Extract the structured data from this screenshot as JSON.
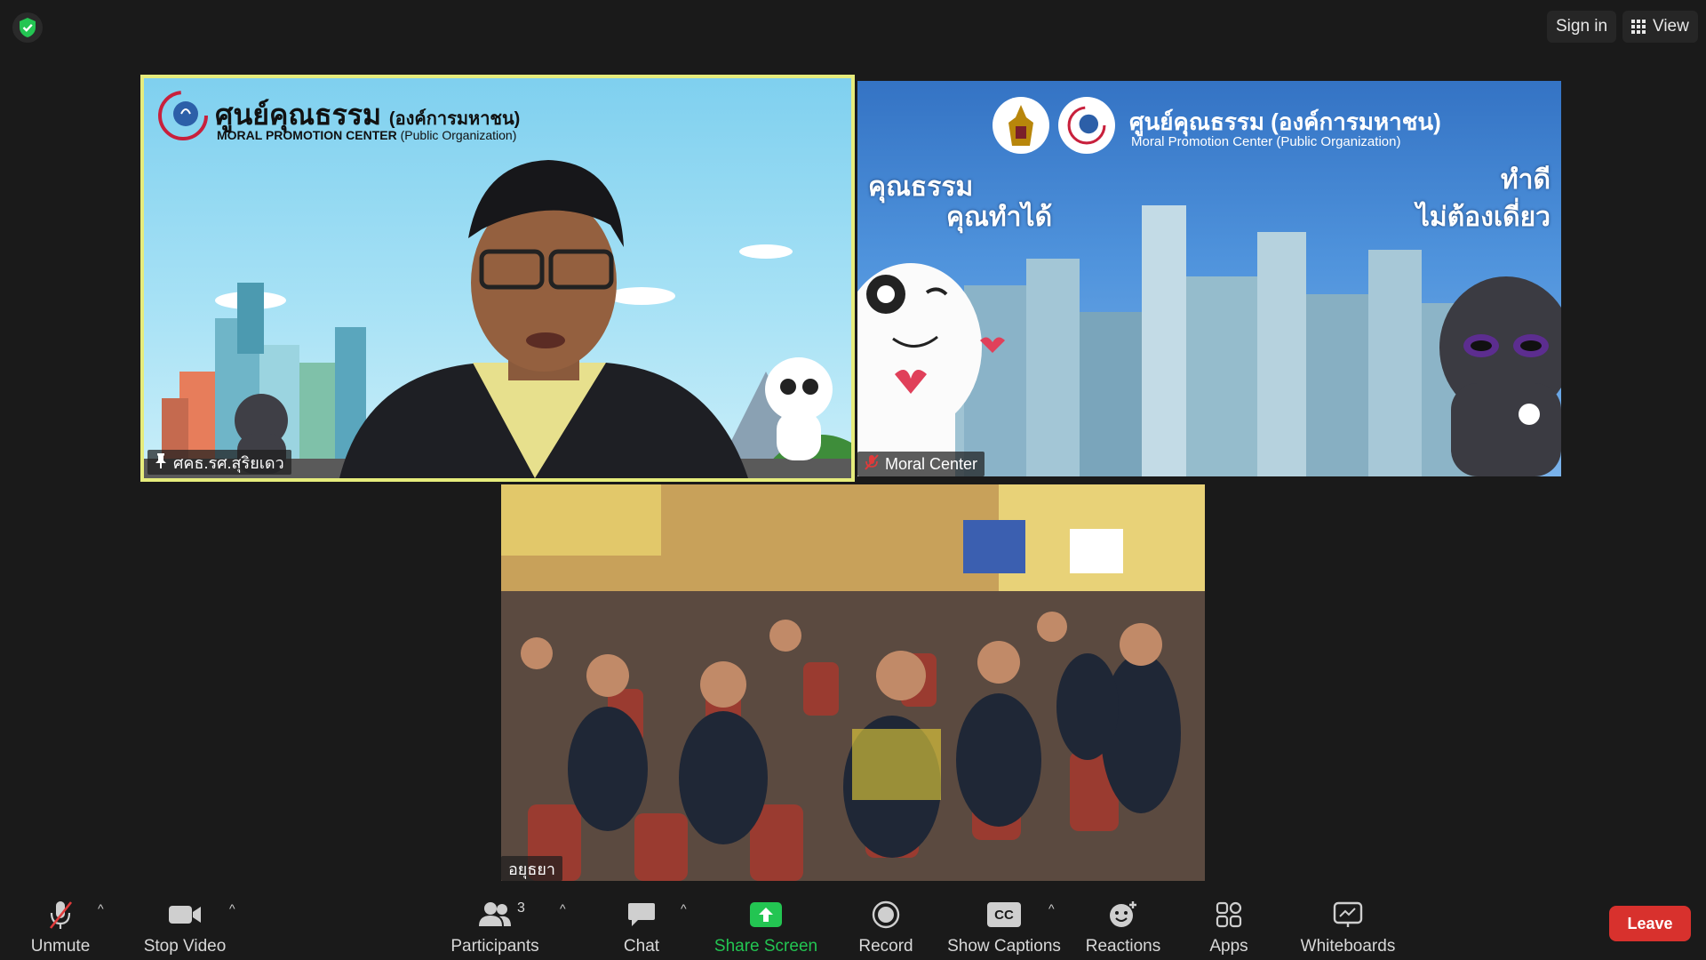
{
  "topbar": {
    "sign_in": "Sign in",
    "view": "View"
  },
  "tiles": {
    "speaker": {
      "name": "ศคธ.รศ.สุริยเดว",
      "banner_title_th": "ศูนย์คุณธรรม",
      "banner_title_paren": "(องค์การมหาชน)",
      "banner_subtitle": "MORAL PROMOTION CENTER",
      "banner_subtitle_paren": "(Public Organization)"
    },
    "moral_center": {
      "name": "Moral Center",
      "banner_title": "ศูนย์คุณธรรม (องค์การมหาชน)",
      "banner_subtitle": "Moral Promotion Center (Public Organization)",
      "slogan_left_1": "คุณธรรม",
      "slogan_left_2": "คุณทำได้",
      "slogan_right_1": "ทำดี",
      "slogan_right_2": "ไม่ต้องเดี่ยว"
    },
    "audience": {
      "name": "อยุธยา"
    }
  },
  "toolbar": {
    "unmute": "Unmute",
    "stop_video": "Stop Video",
    "participants": "Participants",
    "participants_count": "3",
    "chat": "Chat",
    "share_screen": "Share Screen",
    "record": "Record",
    "show_captions": "Show Captions",
    "cc": "CC",
    "reactions": "Reactions",
    "apps": "Apps",
    "whiteboards": "Whiteboards",
    "leave": "Leave"
  },
  "colors": {
    "background": "#1a1a1a",
    "active_speaker_border": "#e6ec7c",
    "share_green": "#23c552",
    "leave_red": "#d8312d"
  }
}
